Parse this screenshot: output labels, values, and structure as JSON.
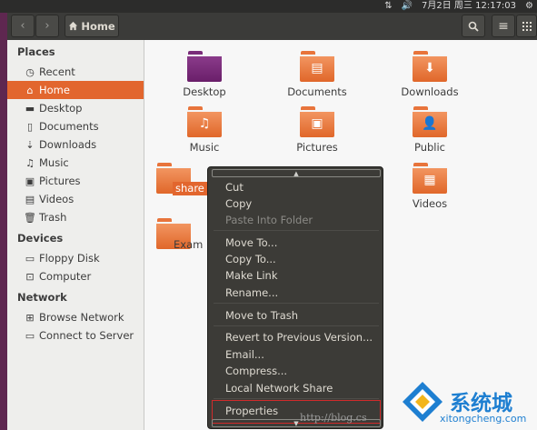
{
  "top_panel": {
    "network_icon": "network-icon",
    "volume_icon": "volume-icon",
    "clock": "7月2日 周三 12:17:03",
    "settings_icon": "gear-icon"
  },
  "header": {
    "back_icon": "‹",
    "forward_icon": "›",
    "path_label": "Home",
    "search_icon": "search-icon",
    "list_icon": "≡",
    "grid_icon": "⋮⋮⋮"
  },
  "sidebar": {
    "places_heading": "Places",
    "places": [
      {
        "label": "Recent",
        "icon": "◷"
      },
      {
        "label": "Home",
        "icon": "⌂"
      },
      {
        "label": "Desktop",
        "icon": "▬"
      },
      {
        "label": "Documents",
        "icon": "▯"
      },
      {
        "label": "Downloads",
        "icon": "⇣"
      },
      {
        "label": "Music",
        "icon": "♫"
      },
      {
        "label": "Pictures",
        "icon": "▣"
      },
      {
        "label": "Videos",
        "icon": "▤"
      },
      {
        "label": "Trash",
        "icon": "🗑"
      }
    ],
    "devices_heading": "Devices",
    "devices": [
      {
        "label": "Floppy Disk",
        "icon": "▭"
      },
      {
        "label": "Computer",
        "icon": "⊡"
      }
    ],
    "network_heading": "Network",
    "network": [
      {
        "label": "Browse Network",
        "icon": "⊞"
      },
      {
        "label": "Connect to Server",
        "icon": "▭"
      }
    ]
  },
  "files": [
    {
      "label": "Desktop",
      "emblem": ""
    },
    {
      "label": "Documents",
      "emblem": "▤"
    },
    {
      "label": "Downloads",
      "emblem": "⬇"
    },
    {
      "label": "Music",
      "emblem": "♫"
    },
    {
      "label": "Pictures",
      "emblem": "▣"
    },
    {
      "label": "Public",
      "emblem": "👤"
    },
    {
      "label": "Videos",
      "emblem": "▦"
    }
  ],
  "partial": {
    "share_label": "share",
    "exam_label": "Exam"
  },
  "context_menu": {
    "up_arrow": "▲",
    "down_arrow": "▼",
    "items": [
      "Cut",
      "Copy",
      "Paste Into Folder",
      "Move To...",
      "Copy To...",
      "Make Link",
      "Rename...",
      "Move to Trash",
      "Revert to Previous Version...",
      "Email...",
      "Compress...",
      "Local Network Share",
      "Properties"
    ]
  },
  "watermark": {
    "url": "http://blog.cs",
    "brand": "系统城",
    "domain": "xitongcheng.com"
  },
  "colors": {
    "accent": "#e2662e",
    "menu_bg": "#3c3b37",
    "highlight_box": "#d12b2b"
  }
}
